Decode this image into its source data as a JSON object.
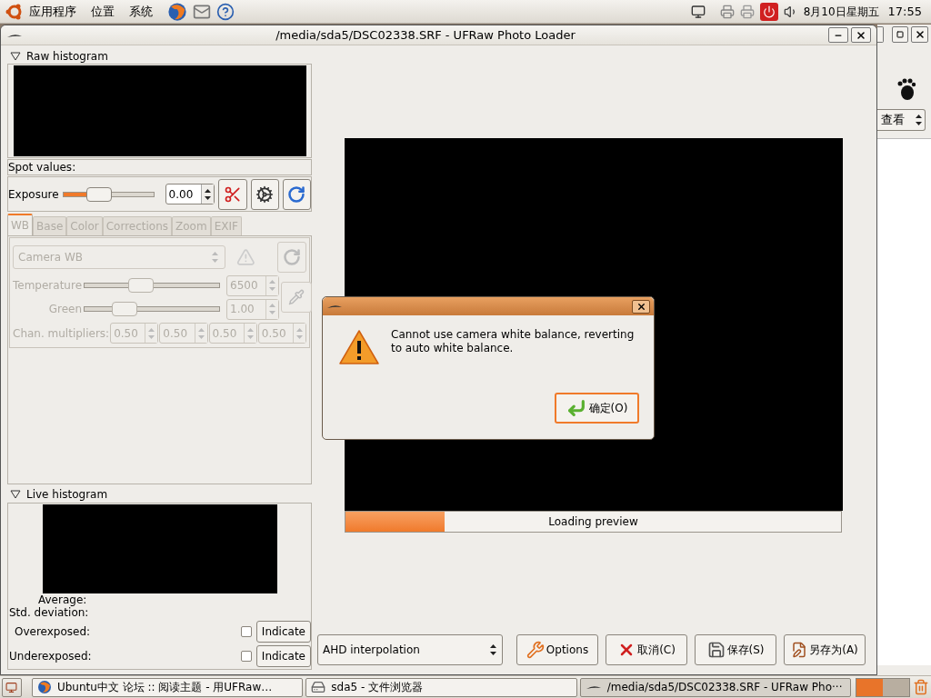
{
  "top_panel": {
    "menus": [
      "应用程序",
      "位置",
      "系统"
    ],
    "date": "8月10日星期五",
    "time": "17:55"
  },
  "background_window": {
    "view_combo": "查看"
  },
  "window": {
    "title": "/media/sda5/DSC02338.SRF - UFRaw Photo Loader",
    "raw_histogram": {
      "title": "Raw histogram",
      "expanded": true
    },
    "spot_values": "Spot values:",
    "exposure": {
      "label": "Exposure",
      "level": 0.4,
      "value": "0.00"
    },
    "tabs": [
      {
        "label": "WB",
        "selected": true
      },
      {
        "label": "Base",
        "selected": false
      },
      {
        "label": "Color",
        "selected": false
      },
      {
        "label": "Corrections",
        "selected": false
      },
      {
        "label": "Zoom",
        "selected": false
      },
      {
        "label": "EXIF",
        "selected": false
      }
    ],
    "wb": {
      "disabled": true,
      "preset": "Camera WB",
      "sliders": [
        {
          "label": "Temperature",
          "level": 0.42,
          "value": "6500"
        },
        {
          "label": "Green",
          "level": 0.3,
          "value": "1.00"
        }
      ],
      "multipliers_label": "Chan. multipliers:",
      "multipliers": [
        "0.50",
        "0.50",
        "0.50",
        "0.50"
      ]
    },
    "live_histogram": {
      "title": "Live histogram",
      "expanded": true,
      "average": "Average:",
      "std_deviation": "Std. deviation:",
      "rows": [
        {
          "label": "Overexposed:",
          "checked": false,
          "button": "Indicate"
        },
        {
          "label": "Underexposed:",
          "checked": false,
          "button": "Indicate"
        }
      ]
    },
    "progress": {
      "level": 0.2,
      "text": "Loading preview"
    },
    "interpolation": "AHD interpolation",
    "buttons": [
      {
        "kind": "options",
        "label": "Options"
      },
      {
        "kind": "cancel",
        "label": "取消(C)"
      },
      {
        "kind": "save",
        "label": "保存(S)"
      },
      {
        "kind": "save_as",
        "label": "另存为(A)"
      }
    ]
  },
  "dialog": {
    "message": "Cannot use camera white balance, reverting to auto white balance.",
    "button": "确定(O)"
  },
  "taskbar": [
    {
      "kind": "browser",
      "label": "Ubuntu中文 论坛 :: 阅读主题 - 用UFRaw…",
      "selected": false
    },
    {
      "kind": "files",
      "label": "sda5 - 文件浏览器",
      "selected": false
    },
    {
      "kind": "ufraw",
      "label": "/media/sda5/DSC02338.SRF - UFRaw Pho···",
      "selected": true
    }
  ]
}
